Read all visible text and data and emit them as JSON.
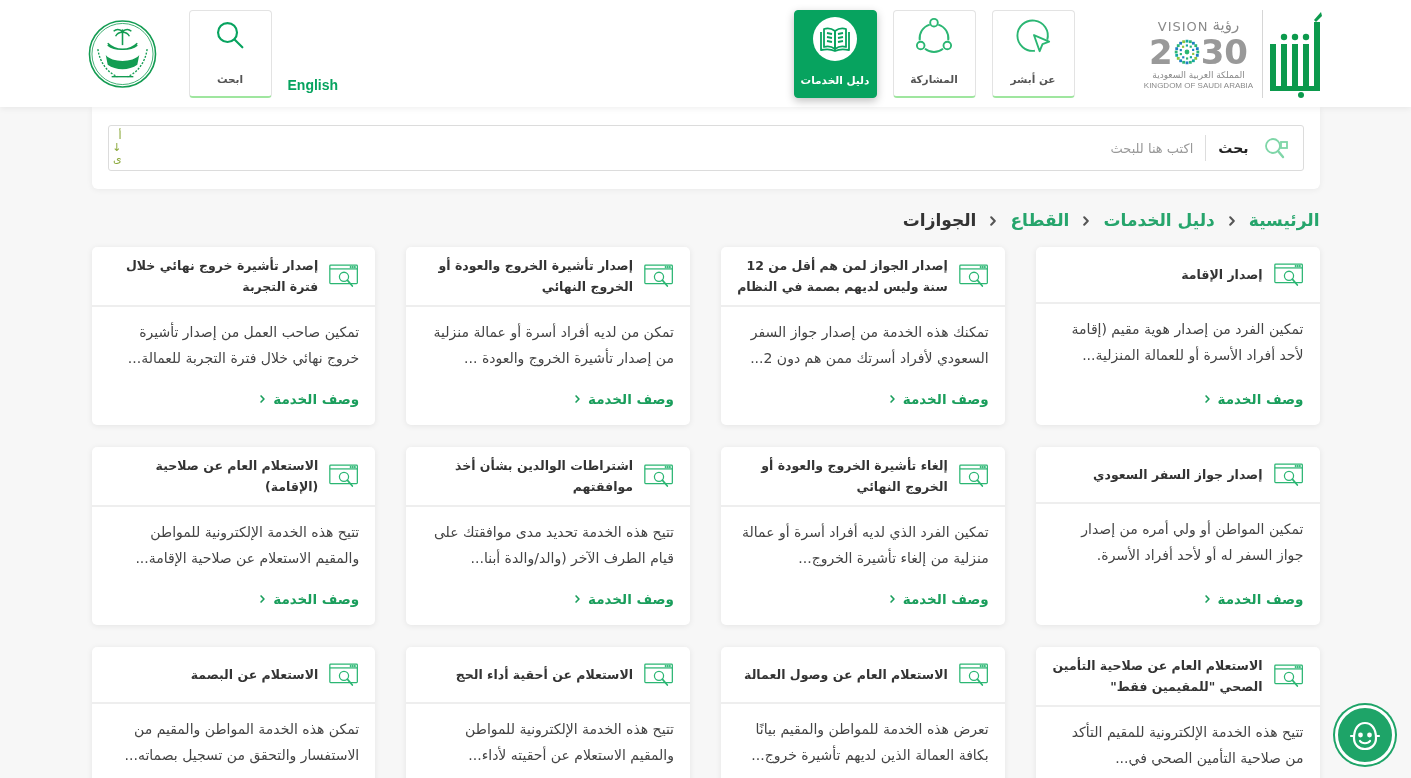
{
  "header": {
    "vision_logo": {
      "arabic": "رؤية",
      "english": "VISION",
      "year_start": "2",
      "year_end": "30",
      "country_ar": "المملكة العربية السعودية",
      "country_en": "KINGDOM OF SAUDI ARABIA"
    },
    "nav_tiles": [
      {
        "kind": "about",
        "label": "عن أبشر",
        "selected": false
      },
      {
        "kind": "participation",
        "label": "المشاركة",
        "selected": false
      },
      {
        "kind": "guide",
        "label": "دليل الخدمات",
        "selected": true
      }
    ],
    "language_link": "English",
    "search_tile": {
      "label": "ابحث"
    }
  },
  "search": {
    "label": "بحث",
    "placeholder": "اكتب هنا للبحث",
    "sort_label": "أ↓ى"
  },
  "breadcrumb": [
    {
      "label": "الرئيسية",
      "selected": false
    },
    {
      "label": "دليل الخدمات",
      "selected": false
    },
    {
      "label": "القطاع",
      "selected": false
    },
    {
      "label": "الجوازات",
      "selected": true
    }
  ],
  "cards": [
    {
      "title": "إصدار الإقامة",
      "description": "تمكين الفرد من إصدار هوية مقيم (إقامة لأحد أفراد الأسرة أو للعمالة المنزلية...",
      "link": "وصف الخدمة"
    },
    {
      "title": "إصدار الجواز لمن هم أقل من 12 سنة وليس لديهم بصمة في النظام",
      "description": "تمكنك هذه الخدمة من إصدار جواز السفر السعودي لأفراد أسرتك ممن هم دون 2...",
      "link": "وصف الخدمة"
    },
    {
      "title": "إصدار تأشيرة الخروج والعودة أو الخروج النهائي",
      "description": "تمكن من لديه أفراد أسرة أو عمالة منزلية من إصدار تأشيرة الخروج والعودة ...",
      "link": "وصف الخدمة"
    },
    {
      "title": "إصدار تأشيرة خروج نهائي خلال فترة التجربة",
      "description": "تمكين صاحب العمل من إصدار تأشيرة خروج نهائي خلال فترة التجربة للعمالة...",
      "link": "وصف الخدمة"
    },
    {
      "title": "إصدار جواز السفر السعودي",
      "description": "تمكين المواطن أو ولي أمره من إصدار جواز السفر له أو لأحد أفراد الأسرة.",
      "link": "وصف الخدمة"
    },
    {
      "title": "إلغاء تأشيرة الخروج والعودة أو الخروج النهائي",
      "description": "تمكين الفرد الذي لديه أفراد أسرة أو عمالة منزلية من إلغاء تأشيرة الخروج...",
      "link": "وصف الخدمة"
    },
    {
      "title": "اشتراطات الوالدين بشأن أخذ موافقتهم",
      "description": "تتيح هذه الخدمة تحديد مدى موافقتك على قيام الطرف الآخر (والد/والدة أبنا...",
      "link": "وصف الخدمة"
    },
    {
      "title": "الاستعلام العام عن صلاحية (الإقامة)",
      "description": "تتيح هذه الخدمة الإلكترونية للمواطن والمقيم الاستعلام عن صلاحية الإقامة...",
      "link": "وصف الخدمة"
    },
    {
      "title": "الاستعلام العام عن صلاحية التأمين الصحي \"للمقيمين فقط\"",
      "description": "تتيح هذه الخدمة الإلكترونية للمقيم التأكد من صلاحية التأمين الصحي في..."
    },
    {
      "title": "الاستعلام العام عن وصول العمالة",
      "description": "تعرض هذه الخدمة للمواطن والمقيم بيانًا بكافة العمالة الذين لديهم تأشيرة خروج..."
    },
    {
      "title": "الاستعلام عن أحقية أداء الحج",
      "description": "تتيح هذه الخدمة الإلكترونية للمواطن والمقيم الاستعلام عن أحقيته لأداء..."
    },
    {
      "title": "الاستعلام عن البصمة",
      "description": "تمكن هذه الخدمة المواطن والمقيم من الاستفسار والتحقق من تسجيل بصماته..."
    }
  ]
}
